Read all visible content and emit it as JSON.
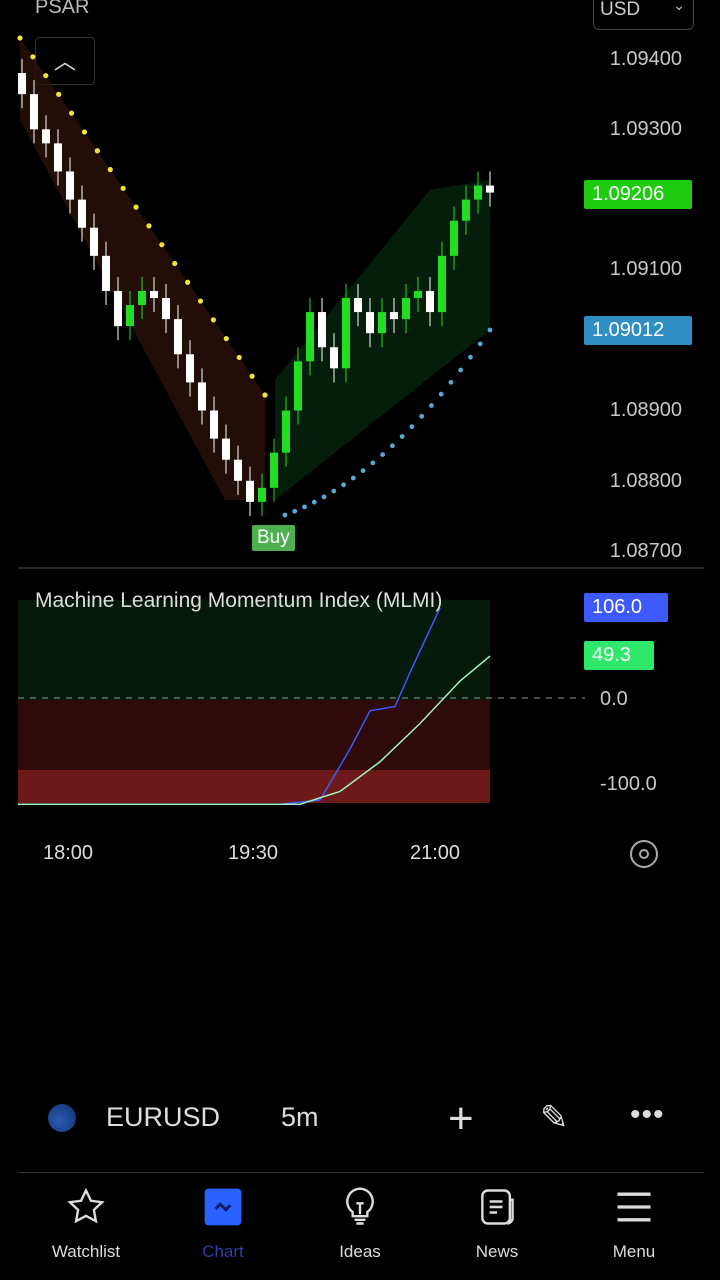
{
  "header": {
    "indicator": "PSAR",
    "currency": "USD"
  },
  "price_axis": [
    "1.09400",
    "1.09300",
    "1.09100",
    "1.08900",
    "1.08800",
    "1.08700"
  ],
  "price_tags": {
    "last": "1.09206",
    "last_color": "#1ecb0f",
    "psar": "1.09012",
    "psar_color": "#2f8fc4"
  },
  "signal": {
    "label": "Buy",
    "color": "#4caf50"
  },
  "candles": {
    "closes": [
      1.0935,
      1.093,
      1.0928,
      1.0924,
      1.092,
      1.0916,
      1.0912,
      1.0907,
      1.0902,
      1.0905,
      1.0907,
      1.0906,
      1.0903,
      1.0898,
      1.0894,
      1.089,
      1.0886,
      1.0883,
      1.088,
      1.0877,
      1.0879,
      1.0884,
      1.089,
      1.0897,
      1.0904,
      1.0899,
      1.0896,
      1.0906,
      1.0904,
      1.0901,
      1.0904,
      1.0903,
      1.0906,
      1.0907,
      1.0904,
      1.0912,
      1.0917,
      1.092,
      1.0922,
      1.0921
    ],
    "up_color": "#22dd22",
    "down_color": "#ffffff"
  },
  "indicator": {
    "title": "Machine Learning Momentum Index (MLMI)",
    "value1": "106.0",
    "value1_color": "#3d5afe",
    "value2": "49.3",
    "value2_color": "#2ee86a",
    "axis": [
      "0.0",
      "-100.0"
    ]
  },
  "time_axis": [
    "18:00",
    "19:30",
    "21:00"
  ],
  "toolbar": {
    "symbol": "EURUSD",
    "interval": "5m"
  },
  "nav": [
    {
      "label": "Watchlist"
    },
    {
      "label": "Chart",
      "active": true
    },
    {
      "label": "Ideas"
    },
    {
      "label": "News"
    },
    {
      "label": "Menu"
    }
  ],
  "accent": "#2962ff"
}
